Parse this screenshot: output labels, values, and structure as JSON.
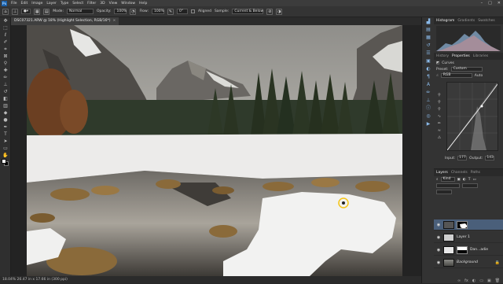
{
  "menubar": {
    "logo": "Ps",
    "items": [
      "File",
      "Edit",
      "Image",
      "Layer",
      "Type",
      "Select",
      "Filter",
      "3D",
      "View",
      "Window",
      "Help"
    ],
    "controls": [
      "–",
      "□",
      "✕"
    ]
  },
  "options": {
    "mode_label": "Mode:",
    "mode_value": "Normal",
    "opacity_label": "Opacity:",
    "opacity_value": "100%",
    "flow_label": "Flow:",
    "flow_value": "100%",
    "angle_value": "0°",
    "aligned_label": "Aligned",
    "sample_label": "Sample:",
    "sample_value": "Current & Below"
  },
  "document": {
    "tab_title": "DSC07321.ARW @ 18% (Highlight Selection, RGB/16*)",
    "close_glyph": "×",
    "status": "18.04%   26.47 in x 17.66 in (300 ppi)"
  },
  "histogram_tabs": [
    "Histogram",
    "Gradients",
    "Swatches"
  ],
  "properties_tabs": [
    "History",
    "Properties",
    "Libraries"
  ],
  "properties": {
    "panel_title": "Curves",
    "preset_label": "Preset:",
    "preset_value": "Custom",
    "channel_value": "RGB",
    "auto_label": "Auto",
    "input_label": "Input:",
    "input_value": "177",
    "output_label": "Output:",
    "output_value": "143"
  },
  "layers_panel": {
    "tabs": [
      "Layers",
      "Channels",
      "Paths"
    ],
    "kind_label": "Kind",
    "rows": [
      {
        "name": "",
        "selected": true
      },
      {
        "name": "Layer 1",
        "selected": false
      },
      {
        "name": "Dan...adie",
        "selected": false
      },
      {
        "name": "Background",
        "selected": false
      }
    ],
    "bottom_tools": [
      "∞",
      "fx",
      "◐",
      "▭",
      "▣",
      "🗑"
    ]
  },
  "colors": {
    "selection": "#4a5f7a",
    "accent": "#8ab9e8"
  }
}
